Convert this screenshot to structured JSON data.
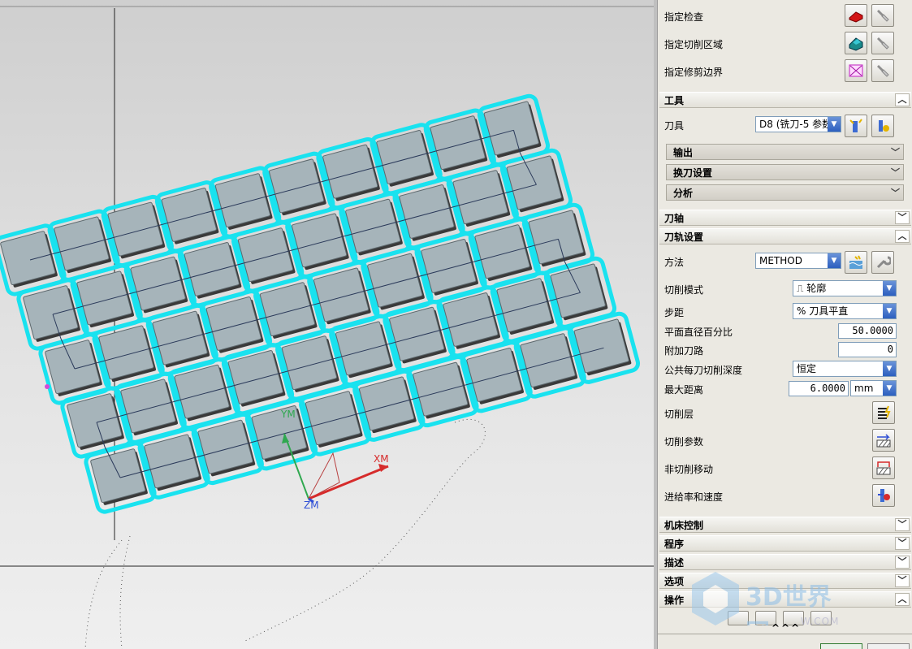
{
  "panel": {
    "geometry": [
      {
        "label": "指定检查",
        "icon": "check-body-icon"
      },
      {
        "label": "指定切削区域",
        "icon": "cut-area-icon"
      },
      {
        "label": "指定修剪边界",
        "icon": "trim-boundary-icon"
      }
    ],
    "tool_section": {
      "title": "工具",
      "tool_label": "刀具",
      "tool_value": "D8 (铣刀-5 参数",
      "subsections": [
        "输出",
        "换刀设置",
        "分析"
      ]
    },
    "axis_section": {
      "title": "刀轴"
    },
    "path_section": {
      "title": "刀轨设置",
      "method_label": "方法",
      "method_value": "METHOD",
      "cut_mode_label": "切削模式",
      "cut_mode_value": "轮廓",
      "stepover_label": "步距",
      "stepover_value": "% 刀具平直",
      "percent_label": "平面直径百分比",
      "percent_value": "50.0000",
      "extra_passes_label": "附加刀路",
      "extra_passes_value": "0",
      "depth_label": "公共每刀切削深度",
      "depth_value": "恒定",
      "max_dist_label": "最大距离",
      "max_dist_value": "6.0000",
      "max_dist_unit": "mm",
      "actions": [
        {
          "label": "切削层",
          "icon": "cut-levels-icon"
        },
        {
          "label": "切削参数",
          "icon": "cut-params-icon"
        },
        {
          "label": "非切削移动",
          "icon": "non-cut-moves-icon"
        },
        {
          "label": "进给率和速度",
          "icon": "feeds-speeds-icon"
        }
      ]
    },
    "collapsed_sections": [
      "机床控制",
      "程序",
      "描述",
      "选项",
      "操作"
    ],
    "watermark": "3D世界网",
    "watermark_sub": "W.COM",
    "bottom_chevrons": "^^^"
  },
  "viewport": {
    "axis_labels": {
      "y": "YM",
      "x": "XM",
      "z": "ZM"
    },
    "colors": {
      "highlight": "#19e2ef",
      "pocket": "#a6b4ba",
      "axis_x": "#d62b2b",
      "axis_y": "#2fa84f",
      "axis_z": "#2f4fd6"
    }
  }
}
